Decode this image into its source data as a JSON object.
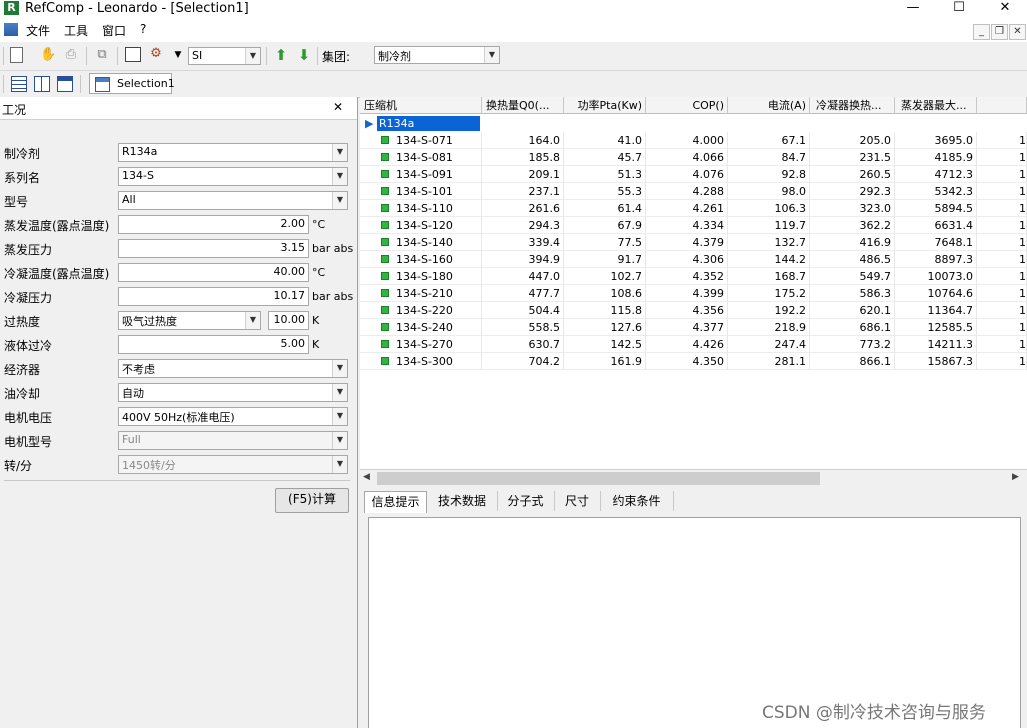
{
  "window": {
    "title": "RefComp - Leonardo  - [Selection1]",
    "minimize": "—",
    "maximize": "☐",
    "close": "✕"
  },
  "menu": {
    "items": [
      "文件",
      "工具",
      "窗口",
      "?"
    ]
  },
  "toolbar": {
    "unit_system": "SI",
    "group_label": "集团:",
    "group_value": "制冷剂",
    "selection_tab": "Selection1"
  },
  "conditions_panel": {
    "title": "工况",
    "close": "✕",
    "refrigerant": {
      "label": "制冷剂",
      "value": "R134a"
    },
    "series": {
      "label": "系列名",
      "value": "134-S"
    },
    "model": {
      "label": "型号",
      "value": "All"
    },
    "evap_temp": {
      "label": "蒸发温度(露点温度)",
      "value": "2.00",
      "unit": "°C"
    },
    "evap_pressure": {
      "label": "蒸发压力",
      "value": "3.15",
      "unit": "bar abs"
    },
    "cond_temp": {
      "label": "冷凝温度(露点温度)",
      "value": "40.00",
      "unit": "°C"
    },
    "cond_pressure": {
      "label": "冷凝压力",
      "value": "10.17",
      "unit": "bar abs"
    },
    "superheat": {
      "label": "过热度",
      "mode": "吸气过热度",
      "value": "10.00",
      "unit": "K"
    },
    "subcooling": {
      "label": "液体过冷",
      "value": "5.00",
      "unit": "K"
    },
    "economizer": {
      "label": "经济器",
      "value": "不考虑"
    },
    "oil_cooling": {
      "label": "油冷却",
      "value": "自动"
    },
    "motor_voltage": {
      "label": "电机电压",
      "value": "400V 50Hz(标准电压)"
    },
    "motor_type": {
      "label": "电机型号",
      "value": "Full"
    },
    "speed": {
      "label": "转/分",
      "value": "1450转/分"
    },
    "calculate_button": "(F5)计算"
  },
  "results_table": {
    "columns": [
      "压缩机",
      "换热量Q0(...",
      "功率Pta(Kw)",
      "COP()",
      "电流(A)",
      "冷凝器换热...",
      "蒸发器最大..."
    ],
    "group_row": "R134a",
    "rows": [
      [
        "134-S-071",
        "164.0",
        "41.0",
        "4.000",
        "67.1",
        "205.0",
        "3695.0"
      ],
      [
        "134-S-081",
        "185.8",
        "45.7",
        "4.066",
        "84.7",
        "231.5",
        "4185.9"
      ],
      [
        "134-S-091",
        "209.1",
        "51.3",
        "4.076",
        "92.8",
        "260.5",
        "4712.3"
      ],
      [
        "134-S-101",
        "237.1",
        "55.3",
        "4.288",
        "98.0",
        "292.3",
        "5342.3"
      ],
      [
        "134-S-110",
        "261.6",
        "61.4",
        "4.261",
        "106.3",
        "323.0",
        "5894.5"
      ],
      [
        "134-S-120",
        "294.3",
        "67.9",
        "4.334",
        "119.7",
        "362.2",
        "6631.4"
      ],
      [
        "134-S-140",
        "339.4",
        "77.5",
        "4.379",
        "132.7",
        "416.9",
        "7648.1"
      ],
      [
        "134-S-160",
        "394.9",
        "91.7",
        "4.306",
        "144.2",
        "486.5",
        "8897.3"
      ],
      [
        "134-S-180",
        "447.0",
        "102.7",
        "4.352",
        "168.7",
        "549.7",
        "10073.0"
      ],
      [
        "134-S-210",
        "477.7",
        "108.6",
        "4.399",
        "175.2",
        "586.3",
        "10764.6"
      ],
      [
        "134-S-220",
        "504.4",
        "115.8",
        "4.356",
        "192.2",
        "620.1",
        "11364.7"
      ],
      [
        "134-S-240",
        "558.5",
        "127.6",
        "4.377",
        "218.9",
        "686.1",
        "12585.5"
      ],
      [
        "134-S-270",
        "630.7",
        "142.5",
        "4.426",
        "247.4",
        "773.2",
        "14211.3"
      ],
      [
        "134-S-300",
        "704.2",
        "161.9",
        "4.350",
        "281.1",
        "866.1",
        "15867.3"
      ]
    ],
    "overflow_cell": "1"
  },
  "bottom_tabs": [
    "信息提示",
    "技术数据",
    "分子式",
    "尺寸",
    "约束条件"
  ],
  "watermark": "CSDN @制冷技术咨询与服务"
}
